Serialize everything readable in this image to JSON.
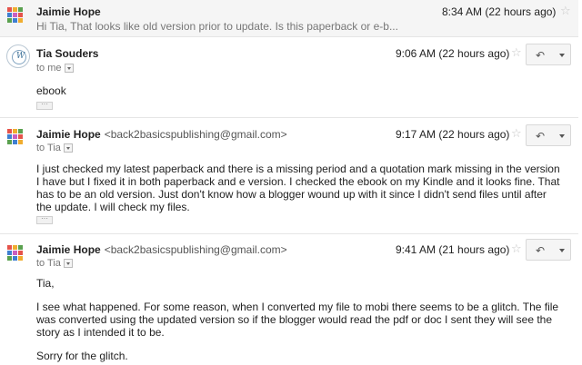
{
  "colors": {
    "time_text": "#222222",
    "muted": "#777777",
    "collapsed_bg": "#f5f5f5",
    "star": "#c6c6c6"
  },
  "messages": [
    {
      "sender": "Jaimie Hope",
      "time": "8:34 AM (22 hours ago)",
      "snippet": "Hi Tia, That looks like old version prior to update. Is this paperback or e-b...",
      "collapsed": true
    },
    {
      "sender": "Tia Souders",
      "time": "9:06 AM (22 hours ago)",
      "to": "to me",
      "body": [
        "ebook"
      ]
    },
    {
      "sender": "Jaimie Hope",
      "email": "<back2basicspublishing@gmail.com>",
      "time": "9:17 AM (22 hours ago)",
      "to": "to Tia",
      "body": [
        "I just checked my latest paperback and there is a missing period and a quotation mark missing in the version I have but I fixed it in both paperback and e version. I checked the ebook on my Kindle and it looks fine. That has to be an old version. Just don't know how a blogger wound up with it since I didn't send files until after the update. I will check my files."
      ]
    },
    {
      "sender": "Jaimie Hope",
      "email": "<back2basicspublishing@gmail.com>",
      "time": "9:41 AM (21 hours ago)",
      "to": "to Tia",
      "body": [
        "Tia,",
        "I see what happened. For some reason, when I converted my file to mobi there seems to be a glitch. The file was converted using the updated version so if the blogger would read the pdf or doc I sent they will see the story as I intended it to be.",
        "Sorry for the glitch."
      ]
    }
  ],
  "icons": {
    "star": "star-icon",
    "reply": "reply-icon",
    "more": "more-options-caret-icon",
    "expand_recipients": "expand-recipients-icon",
    "show_trimmed": "show-trimmed-content-icon"
  }
}
